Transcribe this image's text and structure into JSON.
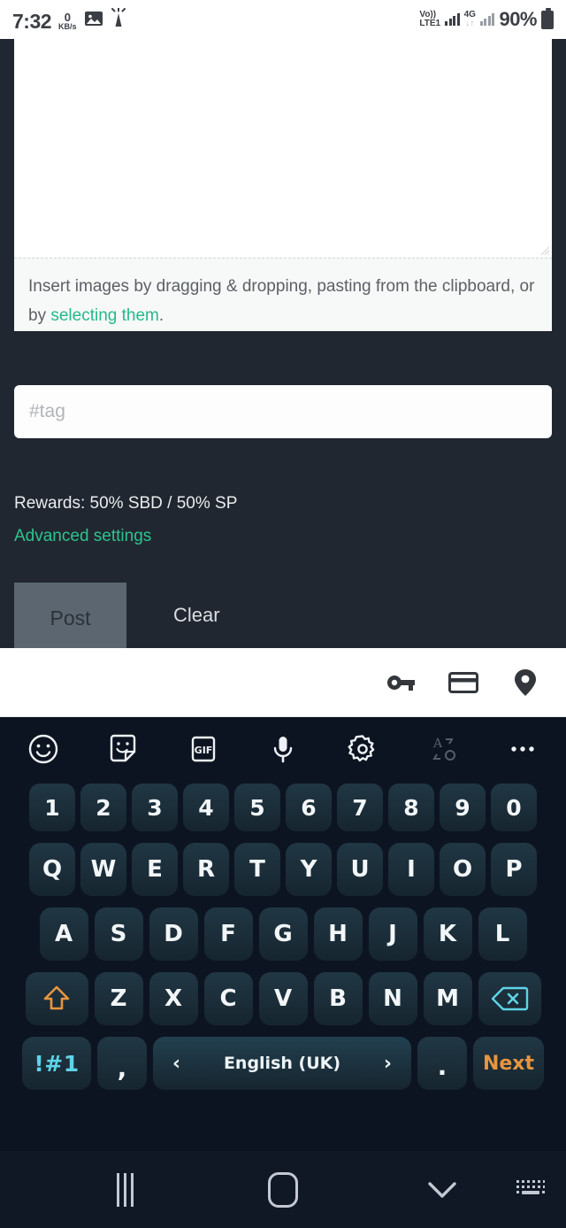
{
  "status_bar": {
    "time": "7:32",
    "net_speed_value": "0",
    "net_speed_unit": "KB/s",
    "image_icon": "image-icon",
    "flashlight_icon": "flashlight-icon",
    "volte_line1": "Vo))",
    "volte_line2": "LTE1",
    "network_type": "4G",
    "data_arrows": "↓↑",
    "battery_percent": "90%"
  },
  "editor": {
    "body_value": "",
    "drop_hint_prefix": "Insert images by dragging & dropping, pasting from the",
    "drop_hint_mid": "clipboard, or by ",
    "drop_hint_link": "selecting them",
    "drop_hint_suffix": ".",
    "tag_placeholder": "#tag",
    "tag_value": ""
  },
  "post_options": {
    "rewards_label": "Rewards: 50% SBD / 50% SP",
    "advanced_settings_label": "Advanced settings",
    "post_button_label": "Post",
    "clear_button_label": "Clear"
  },
  "autofill_bar": {
    "icons": [
      {
        "name": "password-key-icon",
        "label": "key"
      },
      {
        "name": "credit-card-icon",
        "label": "card"
      },
      {
        "name": "location-pin-icon",
        "label": "address"
      }
    ]
  },
  "keyboard": {
    "toolbar": [
      {
        "name": "emoji-icon",
        "label": "emoji",
        "dim": false
      },
      {
        "name": "sticker-icon",
        "label": "sticker",
        "dim": false
      },
      {
        "name": "gif-icon",
        "label": "GIF",
        "dim": false
      },
      {
        "name": "microphone-icon",
        "label": "voice input",
        "dim": false
      },
      {
        "name": "settings-gear-icon",
        "label": "settings",
        "dim": false
      },
      {
        "name": "translate-icon",
        "label": "translate",
        "dim": true
      },
      {
        "name": "more-options-icon",
        "label": "more",
        "dim": false
      }
    ],
    "row_numbers": [
      "1",
      "2",
      "3",
      "4",
      "5",
      "6",
      "7",
      "8",
      "9",
      "0"
    ],
    "row_top": [
      "Q",
      "W",
      "E",
      "R",
      "T",
      "Y",
      "U",
      "I",
      "O",
      "P"
    ],
    "row_home": [
      "A",
      "S",
      "D",
      "F",
      "G",
      "H",
      "J",
      "K",
      "L"
    ],
    "row_bottom": [
      "Z",
      "X",
      "C",
      "V",
      "B",
      "N",
      "M"
    ],
    "shift_key": "shift-key",
    "backspace_key": "backspace-key",
    "symbols_key_label": "!#1",
    "comma_key_label": ",",
    "space_key_label": "English (UK)",
    "space_prev_arrow": "‹",
    "space_next_arrow": "›",
    "period_key_label": ".",
    "next_key_label": "Next"
  },
  "nav_bar": {
    "recents_icon": "recents-icon",
    "home_icon": "home-icon",
    "back_icon": "hide-keyboard-icon",
    "keyboard_switch_icon": "keyboard-switch-icon"
  },
  "colors": {
    "app_background": "#212730",
    "keyboard_background": "#0d1421",
    "key_fill": "#1b2f3b",
    "accent_green": "#2cc48f",
    "accent_cyan": "#5fd4e8",
    "accent_orange": "#e8953f",
    "nav_background": "#101725"
  }
}
